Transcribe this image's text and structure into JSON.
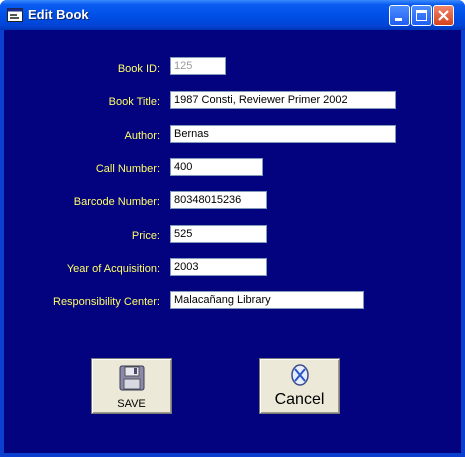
{
  "window": {
    "title": "Edit Book"
  },
  "form": {
    "book_id": {
      "label": "Book ID:",
      "value": "125"
    },
    "book_title": {
      "label": "Book Title:",
      "value": "1987 Consti, Reviewer Primer  2002"
    },
    "author": {
      "label": "Author:",
      "value": "Bernas"
    },
    "call_number": {
      "label": "Call Number:",
      "value": "400"
    },
    "barcode_number": {
      "label": "Barcode Number:",
      "value": "80348015236"
    },
    "price": {
      "label": "Price:",
      "value": "525"
    },
    "year_of_acquisition": {
      "label": "Year of Acquisition:",
      "value": "2003"
    },
    "responsibility_center": {
      "label": "Responsibility Center:",
      "value": "Malacañang Library"
    }
  },
  "buttons": {
    "save": "SAVE",
    "cancel": "Cancel"
  },
  "icons": {
    "window": "form-icon",
    "minimize": "minimize-icon",
    "maximize": "maximize-icon",
    "close": "close-icon",
    "save": "floppy-disk-icon",
    "cancel": "cancel-icon"
  },
  "colors": {
    "client_bg": "#03027f",
    "label_text": "#ffff66",
    "titlebar": "#0050e8"
  }
}
